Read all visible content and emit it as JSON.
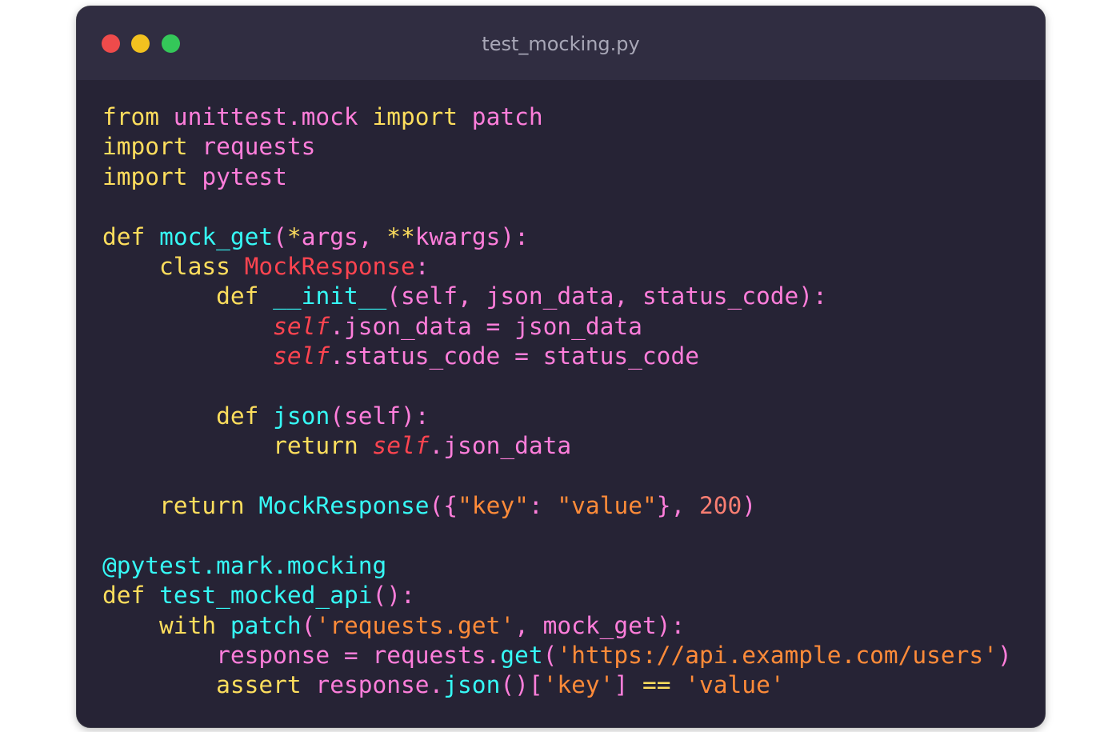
{
  "window": {
    "title": "test_mocking.py",
    "controls": {
      "close": "close",
      "minimize": "minimize",
      "maximize": "maximize"
    },
    "colors": {
      "background": "#262335",
      "titlebar": "#302d41",
      "close": "#ee4b4b",
      "minimize": "#f2c11f",
      "maximize": "#34c759"
    }
  },
  "code": {
    "language": "python",
    "lines": [
      [
        [
          "kw",
          "from"
        ],
        [
          "pink",
          " unittest.mock "
        ],
        [
          "kw",
          "import"
        ],
        [
          "pink",
          " patch"
        ]
      ],
      [
        [
          "kw",
          "import"
        ],
        [
          "pink",
          " requests"
        ]
      ],
      [
        [
          "kw",
          "import"
        ],
        [
          "pink",
          " pytest"
        ]
      ],
      [],
      [
        [
          "kw",
          "def"
        ],
        [
          "pink",
          " "
        ],
        [
          "fn",
          "mock_get"
        ],
        [
          "pink",
          "("
        ],
        [
          "kw",
          "*"
        ],
        [
          "pink",
          "args, "
        ],
        [
          "kw",
          "**"
        ],
        [
          "pink",
          "kwargs):"
        ]
      ],
      [
        [
          "pink",
          "    "
        ],
        [
          "kw",
          "class"
        ],
        [
          "pink",
          " "
        ],
        [
          "cls",
          "MockResponse"
        ],
        [
          "pink",
          ":"
        ]
      ],
      [
        [
          "pink",
          "        "
        ],
        [
          "kw",
          "def"
        ],
        [
          "pink",
          " "
        ],
        [
          "fn",
          "__init__"
        ],
        [
          "pink",
          "(self, json_data, status_code):"
        ]
      ],
      [
        [
          "pink",
          "            "
        ],
        [
          "self",
          "self"
        ],
        [
          "pink",
          ".json_data = json_data"
        ]
      ],
      [
        [
          "pink",
          "            "
        ],
        [
          "self",
          "self"
        ],
        [
          "pink",
          ".status_code = status_code"
        ]
      ],
      [],
      [
        [
          "pink",
          "        "
        ],
        [
          "kw",
          "def"
        ],
        [
          "pink",
          " "
        ],
        [
          "fn",
          "json"
        ],
        [
          "pink",
          "(self):"
        ]
      ],
      [
        [
          "pink",
          "            "
        ],
        [
          "kw",
          "return"
        ],
        [
          "pink",
          " "
        ],
        [
          "self",
          "self"
        ],
        [
          "pink",
          ".json_data"
        ]
      ],
      [],
      [
        [
          "pink",
          "    "
        ],
        [
          "kw",
          "return"
        ],
        [
          "pink",
          " "
        ],
        [
          "fn",
          "MockResponse"
        ],
        [
          "pink",
          "({"
        ],
        [
          "str",
          "\"key\""
        ],
        [
          "pink",
          ": "
        ],
        [
          "str",
          "\"value\""
        ],
        [
          "pink",
          "}, "
        ],
        [
          "num",
          "200"
        ],
        [
          "pink",
          ")"
        ]
      ],
      [],
      [
        [
          "deco",
          "@pytest.mark.mocking"
        ]
      ],
      [
        [
          "kw",
          "def"
        ],
        [
          "pink",
          " "
        ],
        [
          "fn",
          "test_mocked_api"
        ],
        [
          "pink",
          "():"
        ]
      ],
      [
        [
          "pink",
          "    "
        ],
        [
          "kw",
          "with"
        ],
        [
          "pink",
          " "
        ],
        [
          "fn",
          "patch"
        ],
        [
          "pink",
          "("
        ],
        [
          "str",
          "'requests.get'"
        ],
        [
          "pink",
          ", mock_get):"
        ]
      ],
      [
        [
          "pink",
          "        response = requests."
        ],
        [
          "fn",
          "get"
        ],
        [
          "pink",
          "("
        ],
        [
          "str",
          "'https://api.example.com/users'"
        ],
        [
          "pink",
          ")"
        ]
      ],
      [
        [
          "pink",
          "        "
        ],
        [
          "kw",
          "assert"
        ],
        [
          "pink",
          " response."
        ],
        [
          "fn",
          "json"
        ],
        [
          "pink",
          "()["
        ],
        [
          "str",
          "'key'"
        ],
        [
          "pink",
          "] "
        ],
        [
          "kw",
          "=="
        ],
        [
          "pink",
          " "
        ],
        [
          "str",
          "'value'"
        ]
      ]
    ]
  }
}
